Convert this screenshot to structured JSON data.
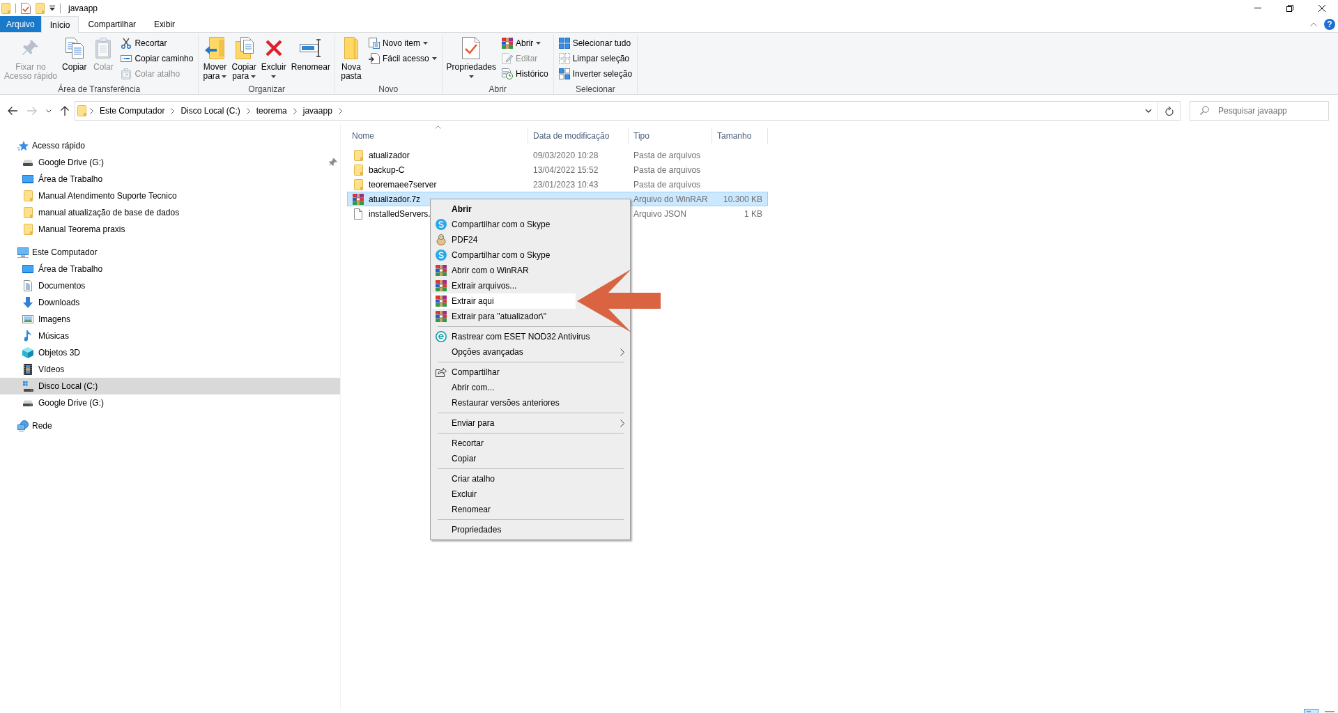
{
  "window": {
    "title": "javaapp",
    "help": "?"
  },
  "ribbon_tabs": [
    {
      "label": "Arquivo",
      "kind": "menu",
      "selected": false
    },
    {
      "label": "Início",
      "kind": "tab",
      "selected": true
    },
    {
      "label": "Compartilhar",
      "kind": "tab",
      "selected": false
    },
    {
      "label": "Exibir",
      "kind": "tab",
      "selected": false
    }
  ],
  "ribbon_groups": [
    {
      "label": "Área de Transferência",
      "buttons": [
        {
          "kind": "large",
          "lines": [
            "Fixar no",
            "Acesso rápido"
          ],
          "disabled": true,
          "dropdown": false
        },
        {
          "kind": "large",
          "lines": [
            "Copiar"
          ],
          "disabled": false,
          "dropdown": false
        },
        {
          "kind": "large",
          "lines": [
            "Colar"
          ],
          "disabled": true,
          "dropdown": false
        },
        {
          "kind": "small",
          "lines": [
            "Recortar"
          ],
          "disabled": false,
          "dropdown": false
        },
        {
          "kind": "small",
          "lines": [
            "Copiar caminho"
          ],
          "disabled": false,
          "dropdown": false
        },
        {
          "kind": "small",
          "lines": [
            "Colar atalho"
          ],
          "disabled": true,
          "dropdown": false
        }
      ]
    },
    {
      "label": "Organizar",
      "buttons": [
        {
          "kind": "large",
          "lines": [
            "Mover",
            "para"
          ],
          "disabled": false,
          "dropdown": true
        },
        {
          "kind": "large",
          "lines": [
            "Copiar",
            "para"
          ],
          "disabled": false,
          "dropdown": true
        },
        {
          "kind": "large",
          "lines": [
            "Excluir"
          ],
          "disabled": false,
          "dropdown": true
        },
        {
          "kind": "large",
          "lines": [
            "Renomear"
          ],
          "disabled": false,
          "dropdown": false
        }
      ]
    },
    {
      "label": "Novo",
      "buttons": [
        {
          "kind": "large",
          "lines": [
            "Nova",
            "pasta"
          ],
          "disabled": false,
          "dropdown": false
        },
        {
          "kind": "small",
          "lines": [
            "Novo item"
          ],
          "disabled": false,
          "dropdown": true
        },
        {
          "kind": "small",
          "lines": [
            "Fácil acesso"
          ],
          "disabled": false,
          "dropdown": true
        }
      ]
    },
    {
      "label": "Abrir",
      "buttons": [
        {
          "kind": "large",
          "lines": [
            "Propriedades"
          ],
          "disabled": false,
          "dropdown": true
        },
        {
          "kind": "small",
          "lines": [
            "Abrir"
          ],
          "disabled": false,
          "dropdown": true
        },
        {
          "kind": "small",
          "lines": [
            "Editar"
          ],
          "disabled": true,
          "dropdown": false
        },
        {
          "kind": "small",
          "lines": [
            "Histórico"
          ],
          "disabled": false,
          "dropdown": false
        }
      ]
    },
    {
      "label": "Selecionar",
      "buttons": [
        {
          "kind": "small",
          "lines": [
            "Selecionar tudo"
          ],
          "disabled": false,
          "dropdown": false
        },
        {
          "kind": "small",
          "lines": [
            "Limpar seleção"
          ],
          "disabled": false,
          "dropdown": false
        },
        {
          "kind": "small",
          "lines": [
            "Inverter seleção"
          ],
          "disabled": false,
          "dropdown": false
        }
      ]
    }
  ],
  "nav_buttons": [
    {
      "kind": "back",
      "disabled": false
    },
    {
      "kind": "forward",
      "disabled": true
    },
    {
      "kind": "recent",
      "disabled": false
    },
    {
      "kind": "up",
      "disabled": false
    }
  ],
  "address_bar": {
    "crumbs": [
      "Este Computador",
      "Disco Local (C:)",
      "teorema",
      "javaapp"
    ]
  },
  "search": {
    "placeholder": "Pesquisar javaapp"
  },
  "sidebar": [
    {
      "label": "Acesso rápido",
      "selected": false,
      "children": [
        {
          "label": "Google Drive (G:)",
          "selected": false,
          "pinned": true
        },
        {
          "label": "Área de Trabalho",
          "selected": false,
          "pinned": false
        },
        {
          "label": "Manual Atendimento Suporte Tecnico",
          "selected": false,
          "pinned": false
        },
        {
          "label": "manual atualização de base de dados",
          "selected": false,
          "pinned": false
        },
        {
          "label": "Manual Teorema praxis",
          "selected": false,
          "pinned": false
        }
      ]
    },
    {
      "label": "Este Computador",
      "selected": false,
      "children": [
        {
          "label": "Área de Trabalho",
          "selected": false
        },
        {
          "label": "Documentos",
          "selected": false
        },
        {
          "label": "Downloads",
          "selected": false
        },
        {
          "label": "Imagens",
          "selected": false
        },
        {
          "label": "Músicas",
          "selected": false
        },
        {
          "label": "Objetos 3D",
          "selected": false
        },
        {
          "label": "Vídeos",
          "selected": false
        },
        {
          "label": "Disco Local (C:)",
          "selected": true
        },
        {
          "label": "Google Drive (G:)",
          "selected": false
        }
      ]
    },
    {
      "label": "Rede",
      "selected": false
    }
  ],
  "file_list": {
    "columns": [
      {
        "label": "Nome",
        "sorted": true
      },
      {
        "label": "Data de modificação",
        "sorted": false
      },
      {
        "label": "Tipo",
        "sorted": false
      },
      {
        "label": "Tamanho",
        "sorted": false
      }
    ],
    "rows": [
      {
        "name": "atualizador",
        "modified": "09/03/2020 10:28",
        "type": "Pasta de arquivos",
        "selected": false
      },
      {
        "name": "backup-C",
        "modified": "13/04/2022 15:52",
        "type": "Pasta de arquivos",
        "selected": false
      },
      {
        "name": "teoremaee7server",
        "modified": "23/01/2023 10:43",
        "type": "Pasta de arquivos",
        "selected": false
      },
      {
        "name": "atualizador.7z",
        "type": "Arquivo do WinRAR",
        "size": "10.300 KB",
        "selected": true
      },
      {
        "name": "installedServers.",
        "type": "Arquivo JSON",
        "size": "1 KB",
        "selected": false
      }
    ]
  },
  "context_menu": {
    "groups": [
      [
        {
          "label": "Abrir",
          "default": true,
          "submenu": false,
          "selected": false
        },
        {
          "label": "Compartilhar com o Skype",
          "default": false,
          "submenu": false,
          "selected": false
        },
        {
          "label": "PDF24",
          "default": false,
          "submenu": false,
          "selected": false
        },
        {
          "label": "Compartilhar com o Skype",
          "default": false,
          "submenu": false,
          "selected": false
        },
        {
          "label": "Abrir com o WinRAR",
          "default": false,
          "submenu": false,
          "selected": false
        },
        {
          "label": "Extrair arquivos...",
          "default": false,
          "submenu": false,
          "selected": false
        },
        {
          "label": "Extrair aqui",
          "default": false,
          "submenu": false,
          "selected": true
        },
        {
          "label": "Extrair para \"atualizador\\\"",
          "default": false,
          "submenu": false,
          "selected": false
        }
      ],
      [
        {
          "label": "Rastrear com ESET NOD32 Antivirus",
          "default": false,
          "submenu": false,
          "selected": false
        },
        {
          "label": "Opções avançadas",
          "default": false,
          "submenu": true,
          "selected": false
        }
      ],
      [
        {
          "label": "Compartilhar",
          "default": false,
          "submenu": false,
          "selected": false
        },
        {
          "label": "Abrir com...",
          "default": false,
          "submenu": false,
          "selected": false
        },
        {
          "label": "Restaurar versões anteriores",
          "default": false,
          "submenu": false,
          "selected": false
        }
      ],
      [
        {
          "label": "Enviar para",
          "default": false,
          "submenu": true,
          "selected": false
        }
      ],
      [
        {
          "label": "Recortar",
          "default": false,
          "submenu": false,
          "selected": false
        },
        {
          "label": "Copiar",
          "default": false,
          "submenu": false,
          "selected": false
        }
      ],
      [
        {
          "label": "Criar atalho",
          "default": false,
          "submenu": false,
          "selected": false
        },
        {
          "label": "Excluir",
          "default": false,
          "submenu": false,
          "selected": false
        },
        {
          "label": "Renomear",
          "default": false,
          "submenu": false,
          "selected": false
        }
      ],
      [
        {
          "label": "Propriedades",
          "default": false,
          "submenu": false,
          "selected": false
        }
      ]
    ]
  },
  "view_buttons": [
    {
      "selected": true
    },
    {
      "selected": false
    }
  ]
}
